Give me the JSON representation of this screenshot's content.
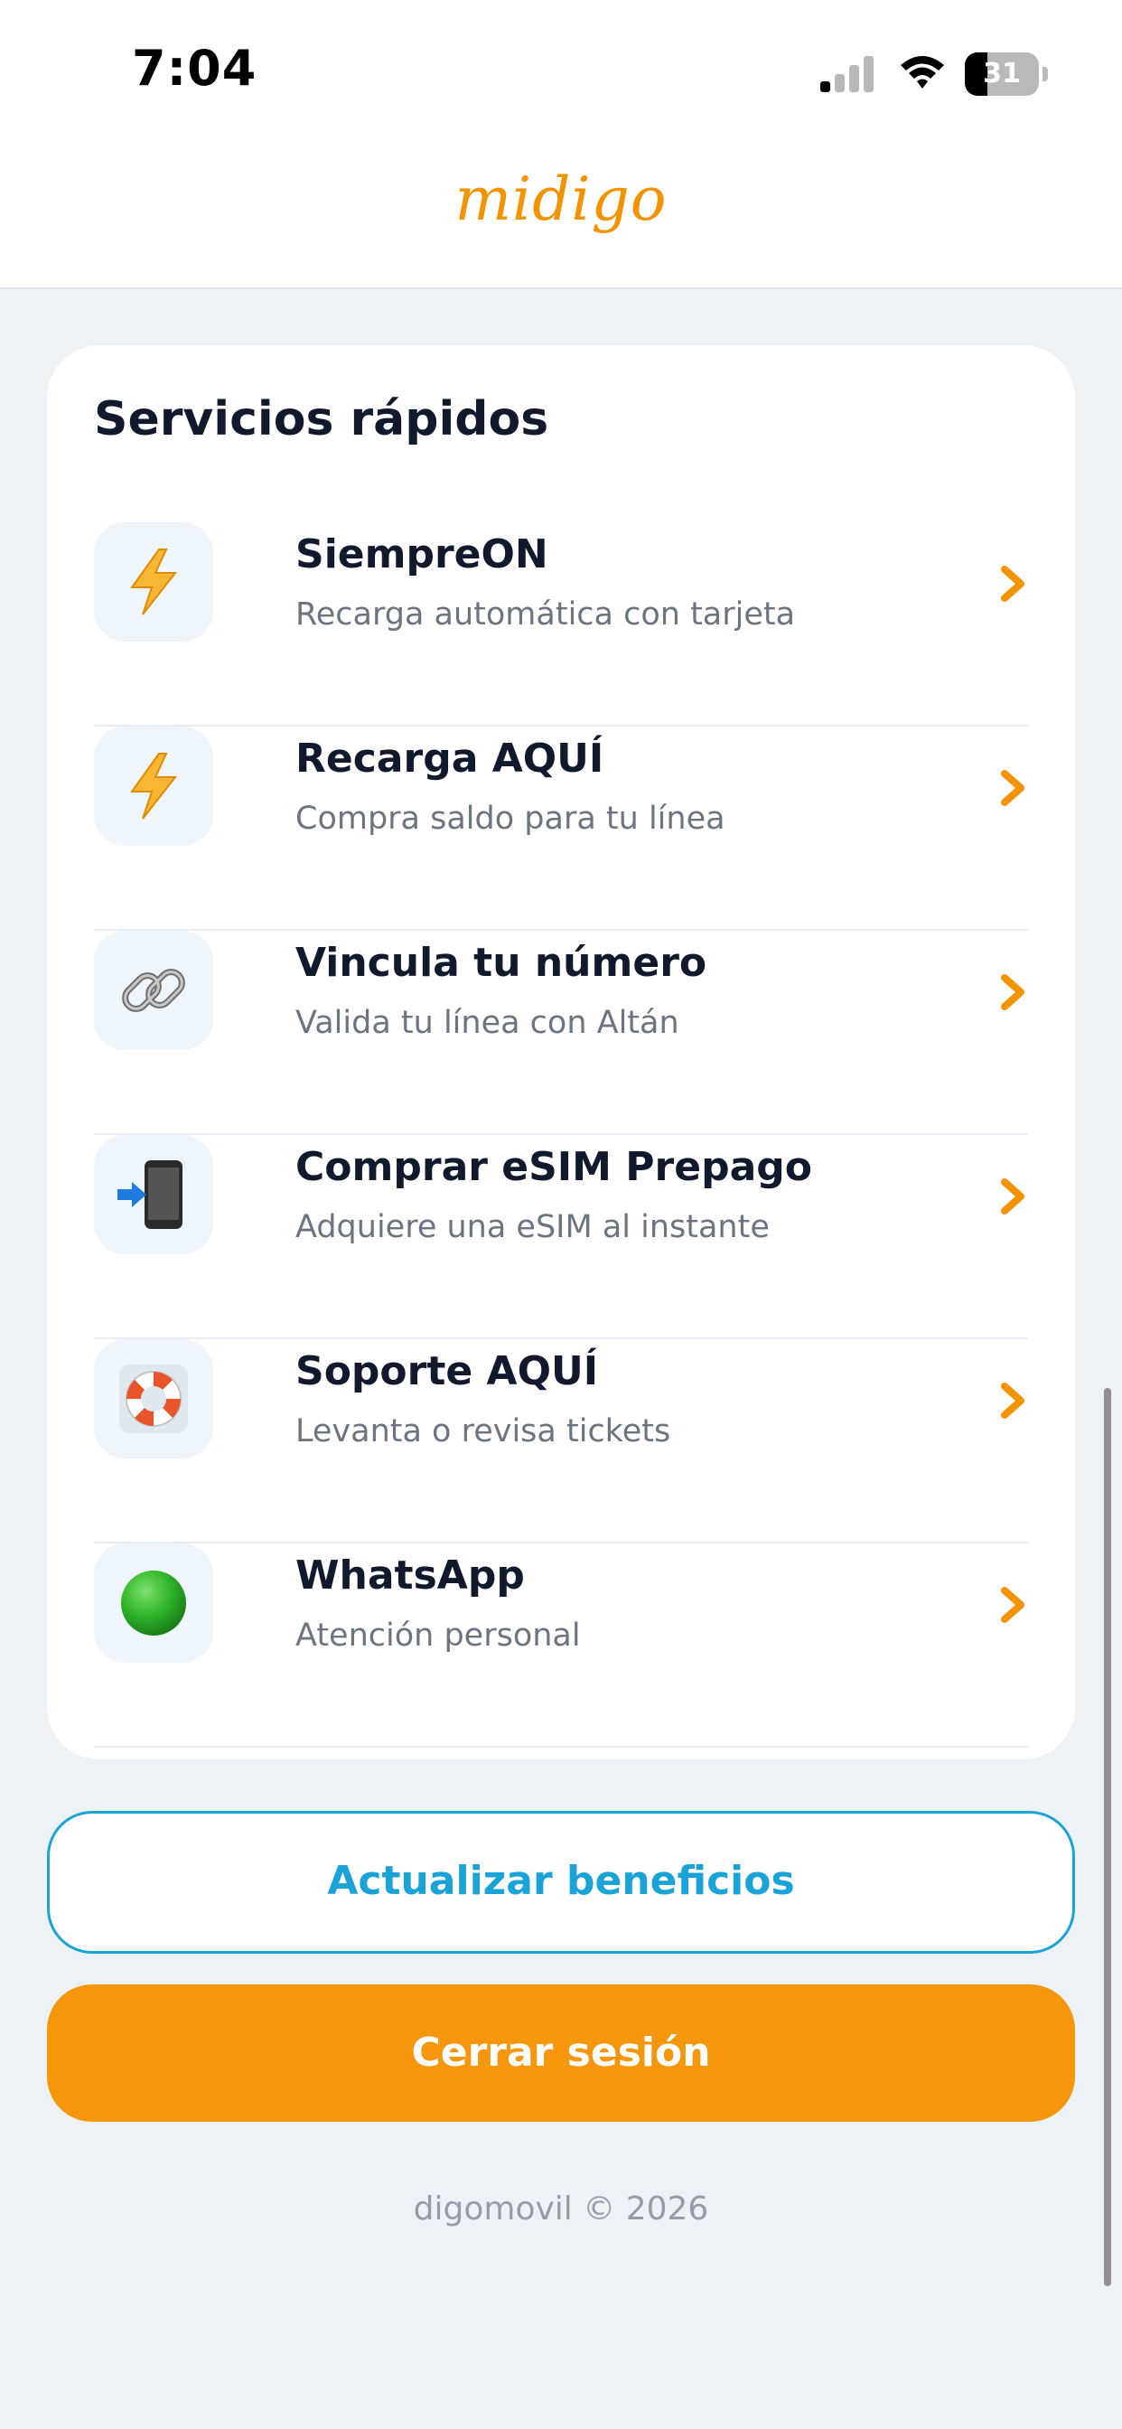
{
  "status_bar": {
    "time": "7:04",
    "battery_level": "31",
    "battery_fraction": 0.31,
    "signal_icon": "cellular-signal-icon",
    "wifi_icon": "wifi-icon"
  },
  "header": {
    "logo": "midigo",
    "logo_color": "#f39300"
  },
  "services": {
    "title": "Servicios rápidos",
    "items": [
      {
        "title": "SiempreON",
        "subtitle": "Recarga automática con tarjeta",
        "icon": "lightning-icon"
      },
      {
        "title": "Recarga AQUÍ",
        "subtitle": "Compra saldo para tu línea",
        "icon": "lightning-icon"
      },
      {
        "title": "Vincula tu número",
        "subtitle": "Valida tu línea con Altán",
        "icon": "link-icon"
      },
      {
        "title": "Comprar eSIM Prepago",
        "subtitle": "Adquiere una eSIM al instante",
        "icon": "mobile-arrow-icon"
      },
      {
        "title": "Soporte AQUÍ",
        "subtitle": "Levanta o revisa tickets",
        "icon": "lifebuoy-icon"
      },
      {
        "title": "WhatsApp",
        "subtitle": "Atención personal",
        "icon": "green-circle-icon"
      }
    ]
  },
  "actions": {
    "update_benefits": "Actualizar beneficios",
    "logout": "Cerrar sesión"
  },
  "footer": {
    "text": "digomovil © 2026"
  },
  "colors": {
    "accent_orange": "#f6960b",
    "accent_blue": "#1aa3d7",
    "background": "#edf2f7",
    "title_text": "#111a2c",
    "subtitle_text": "#6b7480"
  }
}
